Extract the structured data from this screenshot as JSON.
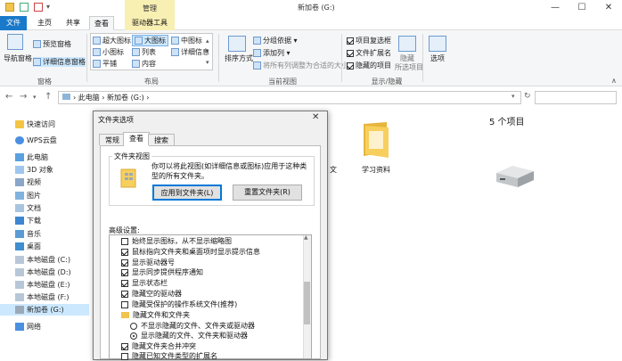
{
  "window": {
    "title": "新加卷 (G:)",
    "context_tab": "管理"
  },
  "ribbon_tabs": [
    "文件",
    "主页",
    "共享",
    "查看",
    "驱动器工具"
  ],
  "ribbon": {
    "panes": {
      "nav_pane": "导航窗格",
      "preview_pane": "预览窗格",
      "details_pane": "详细信息窗格",
      "group_label": "窗格"
    },
    "layout": {
      "items": [
        "超大图标",
        "大图标",
        "中图标",
        "小图标",
        "列表",
        "详细信息",
        "平铺",
        "内容"
      ],
      "group_label": "布局"
    },
    "current_view": {
      "sort": "排序方式",
      "group_by": "分组依据",
      "add_columns": "添加列",
      "fit_columns": "将所有列调整为合适的大小",
      "group_label": "当前视图"
    },
    "show_hide": {
      "item_checkboxes": "项目复选框",
      "file_extensions": "文件扩展名",
      "hidden_items": "隐藏的项目",
      "hide": "隐藏",
      "hide_selected": "所选项目",
      "group_label": "显示/隐藏"
    },
    "options": "选项"
  },
  "address": {
    "segments": [
      "此电脑",
      "新加卷 (G:)"
    ]
  },
  "nav": {
    "items": [
      "快速访问",
      "WPS云盘",
      "此电脑",
      "3D 对象",
      "视频",
      "图片",
      "文档",
      "下载",
      "音乐",
      "桌面",
      "本地磁盘 (C:)",
      "本地磁盘 (D:)",
      "本地磁盘 (E:)",
      "本地磁盘 (F:)",
      "新加卷 (G:)",
      "网络"
    ]
  },
  "content": {
    "item_count": "5 个项目",
    "folder_label": "学习资料",
    "peek_text": "文"
  },
  "dialog": {
    "title": "文件夹选项",
    "tabs": [
      "常规",
      "查看",
      "搜索"
    ],
    "folder_view_title": "文件夹视图",
    "folder_view_desc": "你可以将此视图(如详细信息或图标)应用于这种类型的所有文件夹。",
    "apply_button": "应用到文件夹(L)",
    "reset_button": "重置文件夹(R)",
    "advanced_label": "高级设置:",
    "options": [
      {
        "kind": "check",
        "checked": false,
        "label": "始终显示图标，从不显示缩略图"
      },
      {
        "kind": "check",
        "checked": true,
        "label": "鼠标指向文件夹和桌面项时显示提示信息"
      },
      {
        "kind": "check",
        "checked": true,
        "label": "显示驱动器号"
      },
      {
        "kind": "check",
        "checked": true,
        "label": "显示同步提供程序通知"
      },
      {
        "kind": "check",
        "checked": true,
        "label": "显示状态栏"
      },
      {
        "kind": "check",
        "checked": true,
        "label": "隐藏空的驱动器"
      },
      {
        "kind": "check",
        "checked": false,
        "label": "隐藏受保护的操作系统文件(推荐)"
      },
      {
        "kind": "folder",
        "label": "隐藏文件和文件夹"
      },
      {
        "kind": "radio",
        "checked": false,
        "label": "不显示隐藏的文件、文件夹或驱动器"
      },
      {
        "kind": "radio",
        "checked": true,
        "label": "显示隐藏的文件、文件夹和驱动器"
      },
      {
        "kind": "check",
        "checked": true,
        "label": "隐藏文件夹合并冲突"
      },
      {
        "kind": "check",
        "checked": false,
        "label": "隐藏已知文件类型的扩展名"
      }
    ]
  }
}
